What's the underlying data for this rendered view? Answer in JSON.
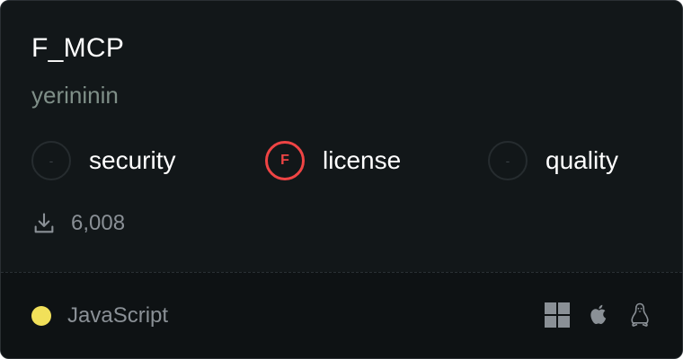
{
  "server": {
    "name": "F_MCP",
    "author": "yerininin"
  },
  "scores": [
    {
      "label": "security",
      "grade": "-"
    },
    {
      "label": "license",
      "grade": "F"
    },
    {
      "label": "quality",
      "grade": "-"
    }
  ],
  "downloads": {
    "icon": "download-icon",
    "count": "6,008"
  },
  "footer": {
    "language": "JavaScript",
    "language_color": "#f1e05a",
    "platforms": [
      "windows-icon",
      "apple-icon",
      "linux-icon"
    ]
  },
  "colors": {
    "fail": "#ef4444",
    "background": "#121719"
  }
}
